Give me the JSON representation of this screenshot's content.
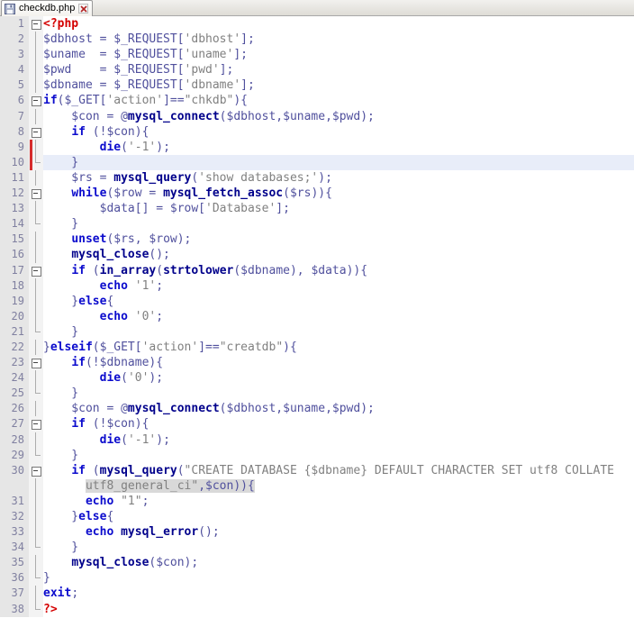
{
  "tab": {
    "title": "checkdb.php"
  },
  "icons": {
    "file": "document-icon",
    "close": "close-x-icon"
  },
  "colors": {
    "php_tag": "#d40000",
    "keyword": "#0b0bcd",
    "function_name": "#00008b",
    "variable": "#50509d",
    "string": "#808080",
    "line_number": "#8080a0",
    "margin_bg": "#e6e6e6",
    "fold_margin_bg": "#f3f3f3",
    "current_line_bg": "#e8edf9",
    "change_marker": "#d62c2c",
    "wrap_highlight_bg": "#d9d9d9",
    "tab_close": "#b22222"
  },
  "editor": {
    "current_line": 10,
    "rows": [
      {
        "n": "1",
        "f": "box",
        "seg": [
          [
            "t",
            "<?php"
          ]
        ]
      },
      {
        "n": "2",
        "f": "line",
        "seg": [
          [
            "v",
            "$dbhost = $_REQUEST["
          ],
          [
            "s",
            "'dbhost'"
          ],
          [
            "v",
            "];"
          ]
        ]
      },
      {
        "n": "3",
        "f": "line",
        "seg": [
          [
            "v",
            "$uname  = $_REQUEST["
          ],
          [
            "s",
            "'uname'"
          ],
          [
            "v",
            "];"
          ]
        ]
      },
      {
        "n": "4",
        "f": "line",
        "seg": [
          [
            "v",
            "$pwd    = $_REQUEST["
          ],
          [
            "s",
            "'pwd'"
          ],
          [
            "v",
            "];"
          ]
        ]
      },
      {
        "n": "5",
        "f": "line",
        "seg": [
          [
            "v",
            "$dbname = $_REQUEST["
          ],
          [
            "s",
            "'dbname'"
          ],
          [
            "v",
            "];"
          ]
        ]
      },
      {
        "n": "6",
        "f": "box",
        "seg": [
          [
            "k",
            "if"
          ],
          [
            "v",
            "($_GET["
          ],
          [
            "s",
            "'action'"
          ],
          [
            "v",
            "]=="
          ],
          [
            "s",
            "\"chkdb\""
          ],
          [
            "v",
            "){"
          ]
        ]
      },
      {
        "n": "7",
        "f": "line",
        "seg": [
          [
            "v",
            "    $con = @"
          ],
          [
            "f",
            "mysql_connect"
          ],
          [
            "v",
            "($dbhost,$uname,$pwd);"
          ]
        ]
      },
      {
        "n": "8",
        "f": "box",
        "seg": [
          [
            "v",
            "    "
          ],
          [
            "k",
            "if"
          ],
          [
            "v",
            " (!$con){"
          ]
        ]
      },
      {
        "n": "9",
        "f": "line",
        "chg": true,
        "seg": [
          [
            "v",
            "        "
          ],
          [
            "k",
            "die"
          ],
          [
            "v",
            "("
          ],
          [
            "s",
            "'-1'"
          ],
          [
            "v",
            ");"
          ]
        ]
      },
      {
        "n": "10",
        "f": "corner",
        "cur": true,
        "chg": true,
        "seg": [
          [
            "v",
            "    }"
          ]
        ]
      },
      {
        "n": "11",
        "f": "line",
        "seg": [
          [
            "v",
            "    $rs = "
          ],
          [
            "f",
            "mysql_query"
          ],
          [
            "v",
            "("
          ],
          [
            "s",
            "'show databases;'"
          ],
          [
            "v",
            ");"
          ]
        ]
      },
      {
        "n": "12",
        "f": "box",
        "seg": [
          [
            "v",
            "    "
          ],
          [
            "k",
            "while"
          ],
          [
            "v",
            "($row = "
          ],
          [
            "f",
            "mysql_fetch_assoc"
          ],
          [
            "v",
            "($rs)){"
          ]
        ]
      },
      {
        "n": "13",
        "f": "line",
        "seg": [
          [
            "v",
            "        $data[] = $row["
          ],
          [
            "s",
            "'Database'"
          ],
          [
            "v",
            "];"
          ]
        ]
      },
      {
        "n": "14",
        "f": "corner",
        "seg": [
          [
            "v",
            "    }"
          ]
        ]
      },
      {
        "n": "15",
        "f": "line",
        "seg": [
          [
            "v",
            "    "
          ],
          [
            "k",
            "unset"
          ],
          [
            "v",
            "($rs, $row);"
          ]
        ]
      },
      {
        "n": "16",
        "f": "line",
        "seg": [
          [
            "v",
            "    "
          ],
          [
            "f",
            "mysql_close"
          ],
          [
            "v",
            "();"
          ]
        ]
      },
      {
        "n": "17",
        "f": "box",
        "seg": [
          [
            "v",
            "    "
          ],
          [
            "k",
            "if"
          ],
          [
            "v",
            " ("
          ],
          [
            "f",
            "in_array"
          ],
          [
            "v",
            "("
          ],
          [
            "f",
            "strtolower"
          ],
          [
            "v",
            "($dbname), $data)){"
          ]
        ]
      },
      {
        "n": "18",
        "f": "line",
        "seg": [
          [
            "v",
            "        "
          ],
          [
            "k",
            "echo"
          ],
          [
            "v",
            " "
          ],
          [
            "s",
            "'1'"
          ],
          [
            "v",
            ";"
          ]
        ]
      },
      {
        "n": "19",
        "f": "line",
        "seg": [
          [
            "v",
            "    }"
          ],
          [
            "k",
            "else"
          ],
          [
            "v",
            "{"
          ]
        ]
      },
      {
        "n": "20",
        "f": "line",
        "seg": [
          [
            "v",
            "        "
          ],
          [
            "k",
            "echo"
          ],
          [
            "v",
            " "
          ],
          [
            "s",
            "'0'"
          ],
          [
            "v",
            ";"
          ]
        ]
      },
      {
        "n": "21",
        "f": "corner",
        "seg": [
          [
            "v",
            "    }"
          ]
        ]
      },
      {
        "n": "22",
        "f": "line",
        "seg": [
          [
            "v",
            "}"
          ],
          [
            "k",
            "elseif"
          ],
          [
            "v",
            "($_GET["
          ],
          [
            "s",
            "'action'"
          ],
          [
            "v",
            "]=="
          ],
          [
            "s",
            "\"creatdb\""
          ],
          [
            "v",
            "){"
          ]
        ]
      },
      {
        "n": "23",
        "f": "box",
        "seg": [
          [
            "v",
            "    "
          ],
          [
            "k",
            "if"
          ],
          [
            "v",
            "(!$dbname){"
          ]
        ]
      },
      {
        "n": "24",
        "f": "line",
        "seg": [
          [
            "v",
            "        "
          ],
          [
            "k",
            "die"
          ],
          [
            "v",
            "("
          ],
          [
            "s",
            "'0'"
          ],
          [
            "v",
            ");"
          ]
        ]
      },
      {
        "n": "25",
        "f": "corner",
        "seg": [
          [
            "v",
            "    }"
          ]
        ]
      },
      {
        "n": "26",
        "f": "line",
        "seg": [
          [
            "v",
            "    $con = @"
          ],
          [
            "f",
            "mysql_connect"
          ],
          [
            "v",
            "($dbhost,$uname,$pwd);"
          ]
        ]
      },
      {
        "n": "27",
        "f": "box",
        "seg": [
          [
            "v",
            "    "
          ],
          [
            "k",
            "if"
          ],
          [
            "v",
            " (!$con){"
          ]
        ]
      },
      {
        "n": "28",
        "f": "line",
        "seg": [
          [
            "v",
            "        "
          ],
          [
            "k",
            "die"
          ],
          [
            "v",
            "("
          ],
          [
            "s",
            "'-1'"
          ],
          [
            "v",
            ");"
          ]
        ]
      },
      {
        "n": "29",
        "f": "corner",
        "seg": [
          [
            "v",
            "    }"
          ]
        ]
      },
      {
        "n": "30",
        "f": "box",
        "seg": [
          [
            "v",
            "    "
          ],
          [
            "k",
            "if"
          ],
          [
            "v",
            " ("
          ],
          [
            "f",
            "mysql_query"
          ],
          [
            "v",
            "("
          ],
          [
            "s",
            "\"CREATE DATABASE {$dbname} DEFAULT CHARACTER SET utf8 COLLATE"
          ]
        ]
      },
      {
        "n": "",
        "f": "line",
        "seg": [
          [
            "v",
            "      "
          ],
          [
            "s hl",
            "utf8_general_ci\""
          ],
          [
            "v hl",
            ",$con)){"
          ]
        ]
      },
      {
        "n": "31",
        "f": "line",
        "seg": [
          [
            "v",
            "      "
          ],
          [
            "k",
            "echo"
          ],
          [
            "v",
            " "
          ],
          [
            "s",
            "\"1\""
          ],
          [
            "v",
            ";"
          ]
        ]
      },
      {
        "n": "32",
        "f": "line",
        "seg": [
          [
            "v",
            "    }"
          ],
          [
            "k",
            "else"
          ],
          [
            "v",
            "{"
          ]
        ]
      },
      {
        "n": "33",
        "f": "line",
        "seg": [
          [
            "v",
            "      "
          ],
          [
            "k",
            "echo"
          ],
          [
            "v",
            " "
          ],
          [
            "f",
            "mysql_error"
          ],
          [
            "v",
            "();"
          ]
        ]
      },
      {
        "n": "34",
        "f": "corner",
        "seg": [
          [
            "v",
            "    }"
          ]
        ]
      },
      {
        "n": "35",
        "f": "line",
        "seg": [
          [
            "v",
            "    "
          ],
          [
            "f",
            "mysql_close"
          ],
          [
            "v",
            "($con);"
          ]
        ]
      },
      {
        "n": "36",
        "f": "corner",
        "seg": [
          [
            "v",
            "}"
          ]
        ]
      },
      {
        "n": "37",
        "f": "line",
        "seg": [
          [
            "k",
            "exit"
          ],
          [
            "v",
            ";"
          ]
        ]
      },
      {
        "n": "38",
        "f": "corner",
        "seg": [
          [
            "t",
            "?>"
          ]
        ]
      }
    ]
  }
}
